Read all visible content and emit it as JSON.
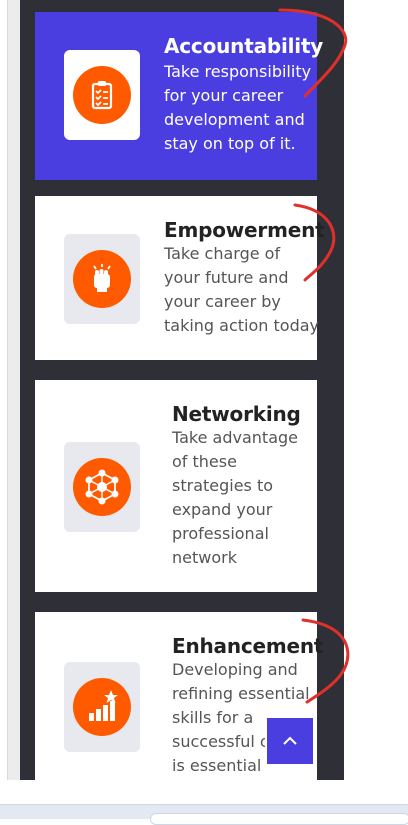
{
  "cards": [
    {
      "title": "Accountability",
      "desc": "Take responsibility for your career development and stay on top of it.",
      "icon": "clipboard-checklist-icon"
    },
    {
      "title": "Empowerment",
      "desc": "Take charge of your future and your career by taking action today",
      "icon": "raised-fist-icon"
    },
    {
      "title": "Networking",
      "desc": "Take advantage of these strategies to expand your professional network",
      "icon": "network-nodes-icon"
    },
    {
      "title": "Enhancement",
      "desc": "Developing and refining essential skills for a successful career is essential",
      "icon": "growth-chart-star-icon"
    }
  ],
  "colors": {
    "accent": "#4b3ee0",
    "icon_orange": "#ff5a00",
    "annotation_red": "#e0302a"
  },
  "scroll_top_icon": "chevron-up-icon"
}
